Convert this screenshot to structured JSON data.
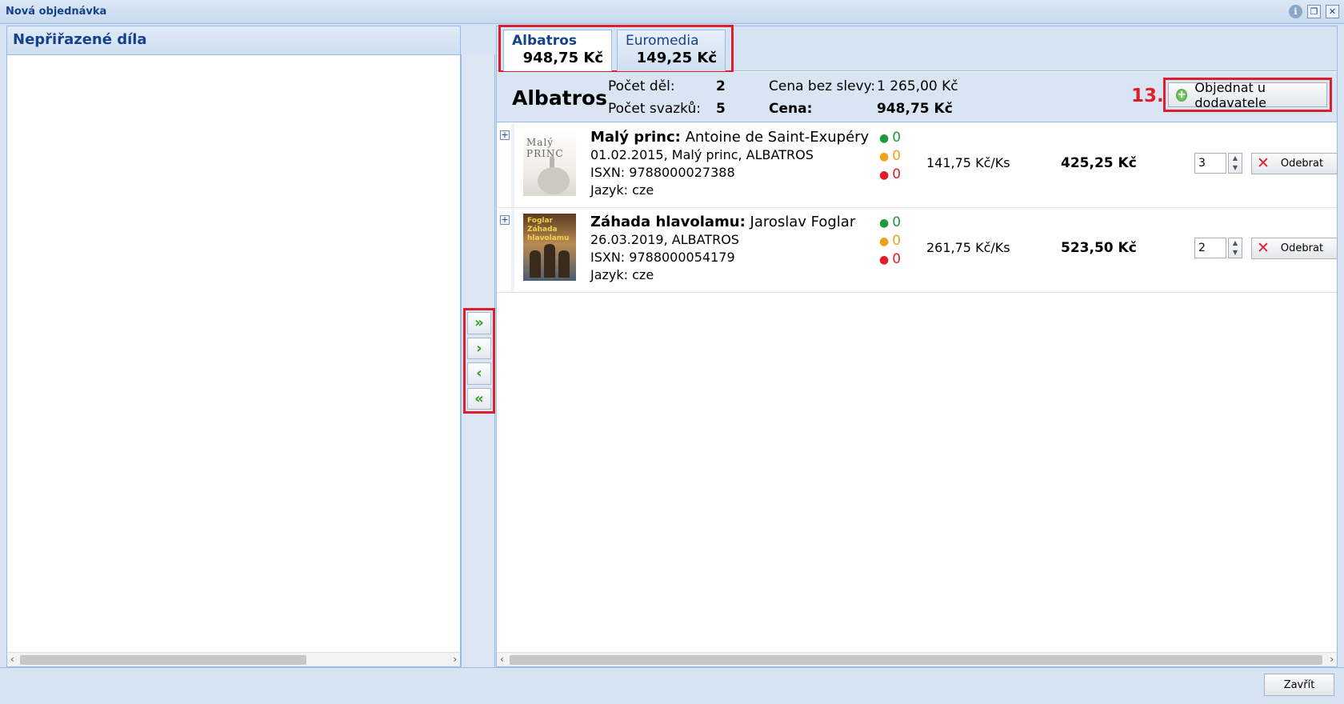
{
  "window": {
    "title": "Nová objednávka"
  },
  "left_panel": {
    "title": "Nepřiřazené díla"
  },
  "transfer": {
    "move_all_right": "»",
    "move_right": "›",
    "move_left": "‹",
    "move_all_left": "«"
  },
  "tabs": [
    {
      "name": "Albatros",
      "amount": "948,75 Kč"
    },
    {
      "name": "Euromedia",
      "amount": "149,25 Kč"
    }
  ],
  "summary": {
    "supplier": "Albatros",
    "works_label": "Počet děl:",
    "works_value": "2",
    "volumes_label": "Počet svazků:",
    "volumes_value": "5",
    "price_no_discount_label": "Cena bez slevy:",
    "price_no_discount_value": "1 265,00 Kč",
    "price_label": "Cena:",
    "price_value": "948,75 Kč",
    "step": "13.",
    "order_button": "Objednat u dodavatele"
  },
  "items": [
    {
      "title": "Malý princ:",
      "author": "Antoine de Saint-Exupéry",
      "line2": "01.02.2015, Malý princ, ALBATROS",
      "isxn": "ISXN: 9788000027388",
      "lang": "Jazyk: cze",
      "cover_text": "Malý PRINC",
      "stock_green": "0",
      "stock_orange": "0",
      "stock_red": "0",
      "unit_price": "141,75 Kč/Ks",
      "total": "425,25 Kč",
      "qty": "3",
      "remove": "Odebrat"
    },
    {
      "title": "Záhada hlavolamu:",
      "author": "Jaroslav Foglar",
      "line2": "26.03.2019, ALBATROS",
      "isxn": "ISXN: 9788000054179",
      "lang": "Jazyk: cze",
      "cover_text": "Foglar Záhada hlavolamu",
      "stock_green": "0",
      "stock_orange": "0",
      "stock_red": "0",
      "unit_price": "261,75 Kč/Ks",
      "total": "523,50 Kč",
      "qty": "2",
      "remove": "Odebrat"
    }
  ],
  "footer": {
    "close": "Zavřít"
  }
}
